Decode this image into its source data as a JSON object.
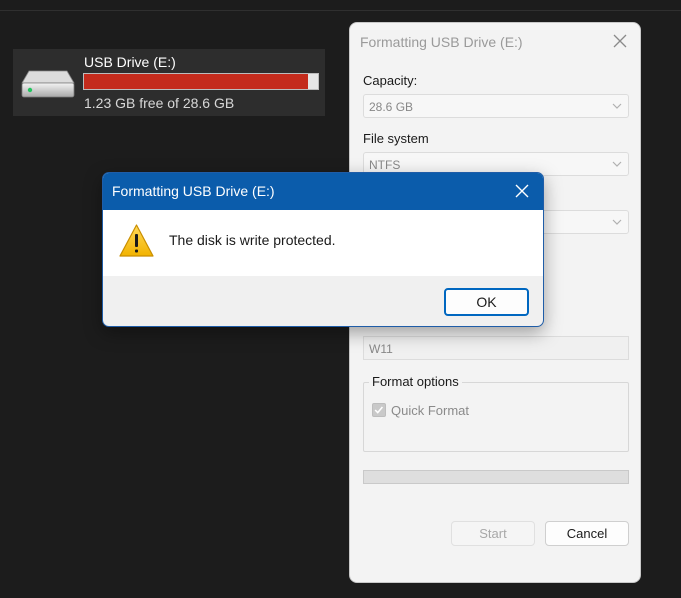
{
  "drive": {
    "name": "USB Drive (E:)",
    "free_text": "1.23 GB free of 28.6 GB",
    "used_fraction": 0.957,
    "bar_color": "#c42b1c"
  },
  "format_dialog": {
    "title": "Formatting USB Drive (E:)",
    "capacity_label": "Capacity:",
    "capacity_value": "28.6 GB",
    "filesystem_label": "File system",
    "filesystem_value": "NTFS",
    "volume_label_value": "W11",
    "format_options_label": "Format options",
    "quick_format_label": "Quick Format",
    "quick_format_checked": true,
    "start_label": "Start",
    "cancel_label": "Cancel"
  },
  "error_dialog": {
    "title": "Formatting USB Drive (E:)",
    "message": "The disk is write protected.",
    "ok_label": "OK",
    "icon": "warning-icon",
    "accent_color": "#0b5cab"
  }
}
